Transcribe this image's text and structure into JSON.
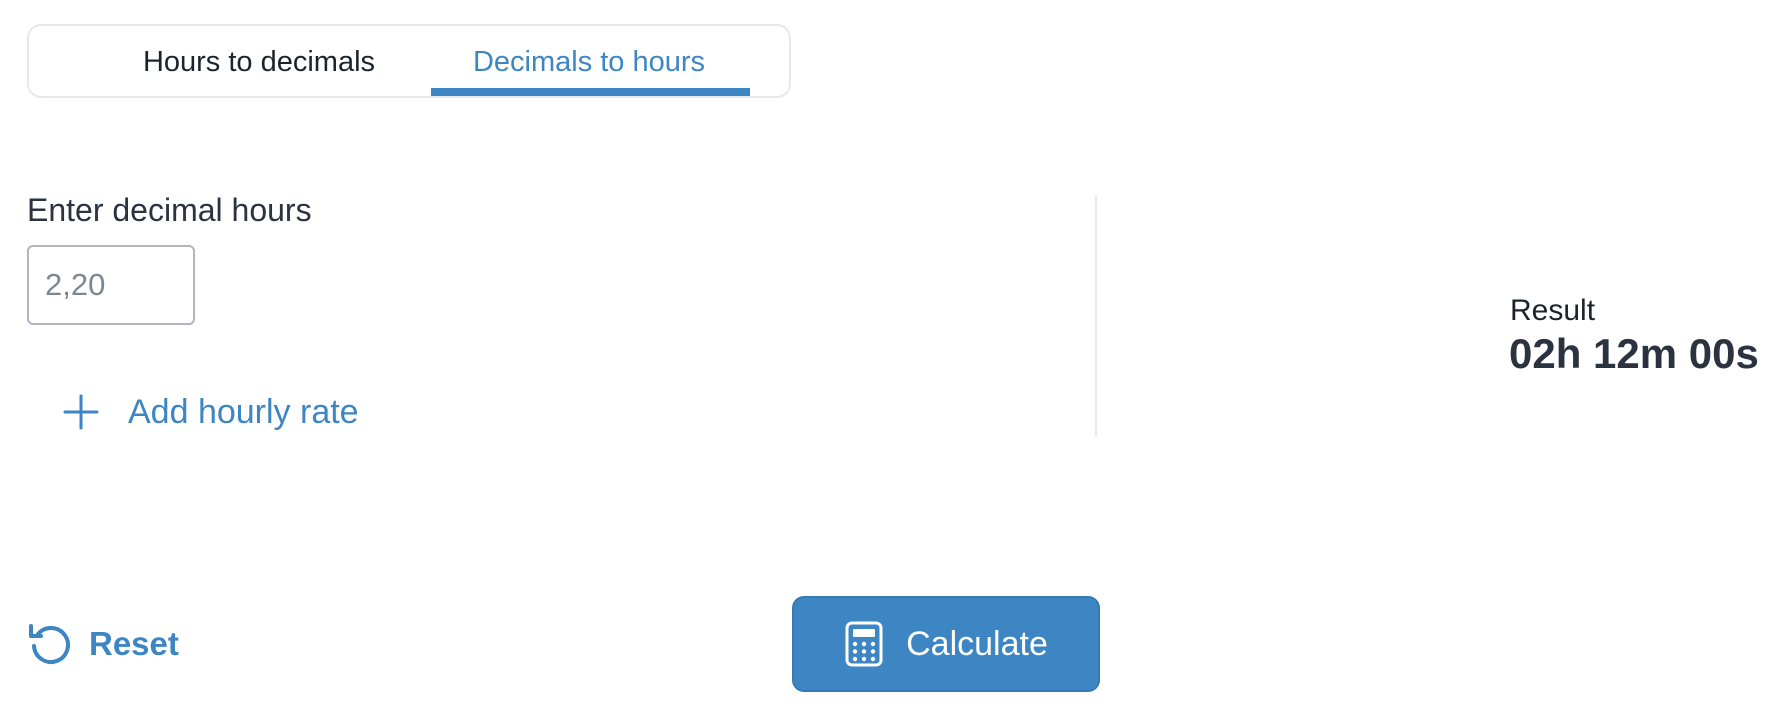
{
  "tabs": [
    {
      "label": "Hours to decimals",
      "active": false
    },
    {
      "label": "Decimals to hours",
      "active": true
    }
  ],
  "form": {
    "label": "Enter decimal hours",
    "value": "",
    "placeholder": "2,20",
    "add_rate_label": "Add hourly rate",
    "add_rate_icon": "plus-icon"
  },
  "result": {
    "label": "Result",
    "value": "02h 12m 00s"
  },
  "actions": {
    "reset_label": "Reset",
    "reset_icon": "reset-icon",
    "calculate_label": "Calculate",
    "calculate_icon": "calculator-icon"
  },
  "colors": {
    "accent": "#3d86c3",
    "text": "#2b3340",
    "border": "#e5e8ec"
  }
}
